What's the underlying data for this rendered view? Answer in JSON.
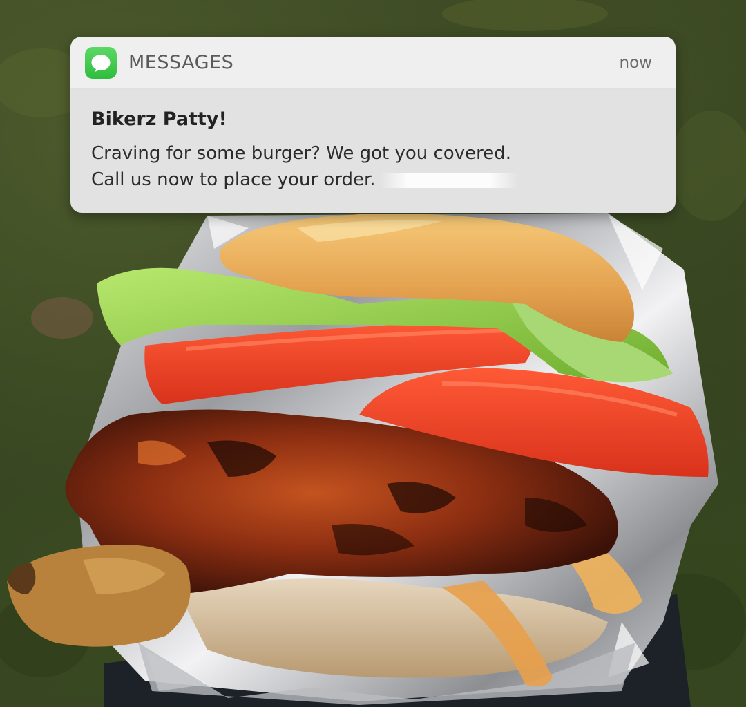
{
  "photo": {
    "subject": "burger-in-foil"
  },
  "notification": {
    "app_icon": "messages-bubble-icon",
    "app_name": "MESSAGES",
    "time": "now",
    "title": "Bikerz Patty!",
    "line1": "Craving for some burger? We got you covered.",
    "line2": "Call us now to place your order.",
    "accent_color": "#34c759"
  }
}
